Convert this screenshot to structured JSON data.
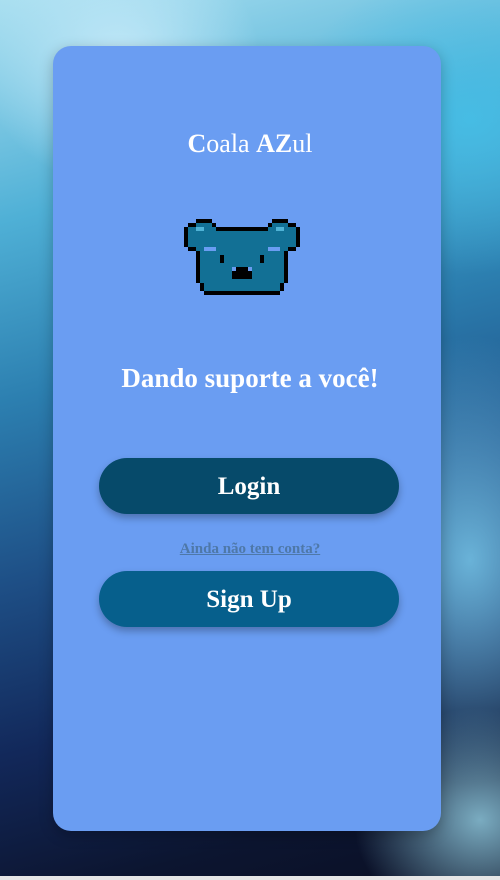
{
  "app": {
    "title_part1": "C",
    "title_part2": "oala ",
    "title_part3": "AZ",
    "title_part4": "ul"
  },
  "hero": {
    "logo_icon": "koala-pixel-icon",
    "tagline": "Dando suporte a você!"
  },
  "actions": {
    "login_label": "Login",
    "signup_prompt": "Ainda não tem conta?",
    "signup_label": "Sign Up"
  },
  "colors": {
    "card": "#6a9df2",
    "login_button": "#064a6a",
    "signup_button": "#065f8c",
    "koala_fill": "#127095",
    "koala_outline": "#000000"
  }
}
